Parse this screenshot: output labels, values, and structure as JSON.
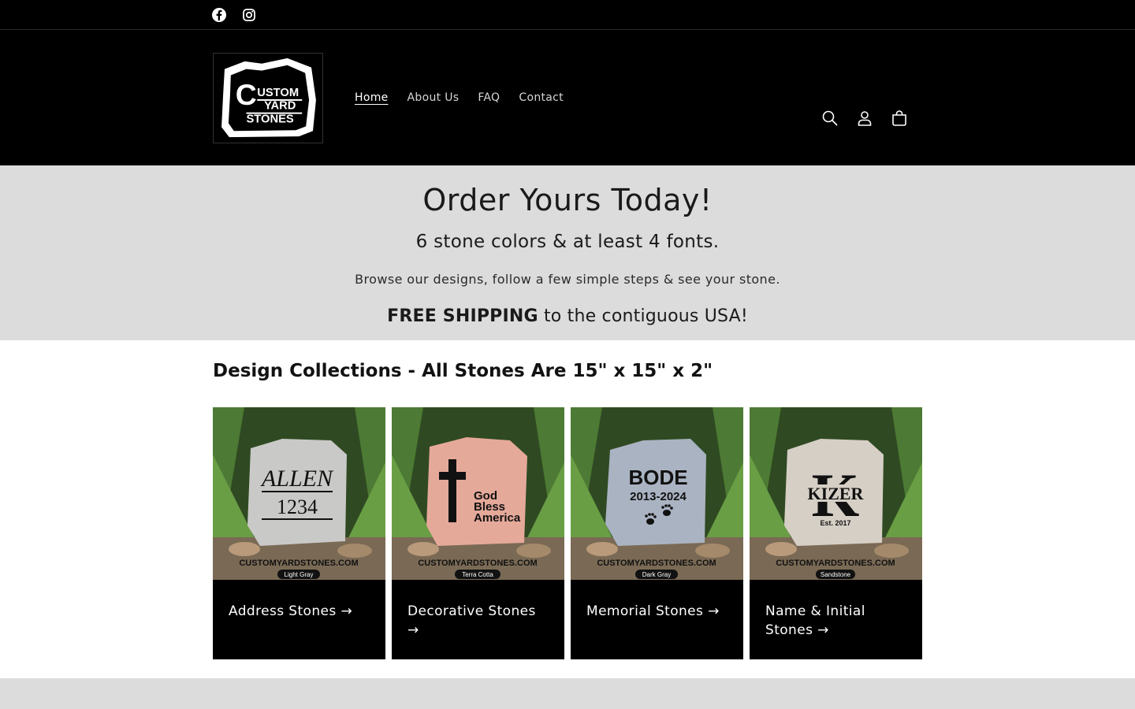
{
  "social": {
    "icons": [
      "facebook-icon",
      "instagram-icon"
    ]
  },
  "header": {
    "logo_lines": [
      "USTOM",
      "YARD",
      "STONES"
    ],
    "logo_initial": "C",
    "nav": [
      {
        "label": "Home",
        "active": true
      },
      {
        "label": "About Us",
        "active": false
      },
      {
        "label": "FAQ",
        "active": false
      },
      {
        "label": "Contact",
        "active": false
      }
    ],
    "icons": [
      "search-icon",
      "account-icon",
      "cart-icon"
    ]
  },
  "banner": {
    "heading": "Order Yours Today!",
    "subheading": "6 stone colors & at least 4 fonts.",
    "body": "Browse our designs, follow a few simple steps & see your stone.",
    "shipping_bold": "FREE SHIPPING",
    "shipping_rest": " to the contiguous USA!"
  },
  "collections": {
    "title_bold": "Design Collections",
    "title_rest": " - All Stones Are 15\" x 15\" x 2\"",
    "cards": [
      {
        "label": "Address Stones →",
        "stone_color": "#c9c9c7",
        "color_tag": "Light Gray",
        "text_lines": [
          "ALLEN",
          "1234"
        ]
      },
      {
        "label": "Decorative Stones →",
        "stone_color": "#e5a99a",
        "color_tag": "Terra Cotta",
        "text_lines": [
          "God",
          "Bless",
          "America"
        ]
      },
      {
        "label": "Memorial Stones →",
        "stone_color": "#aab3c2",
        "color_tag": "Dark Gray",
        "text_lines": [
          "BODE",
          "2013-2024"
        ]
      },
      {
        "label": "Name & Initial Stones →",
        "stone_color": "#d6cfc6",
        "color_tag": "Sandstone",
        "text_lines": [
          "K",
          "KIZER",
          "Est. 2017"
        ]
      }
    ],
    "watermark": "CUSTOMYARDSTONES.COM"
  },
  "colors": {
    "header_bg": "#000000",
    "banner_bg": "#dcdcdc",
    "card_bg": "#000000"
  }
}
